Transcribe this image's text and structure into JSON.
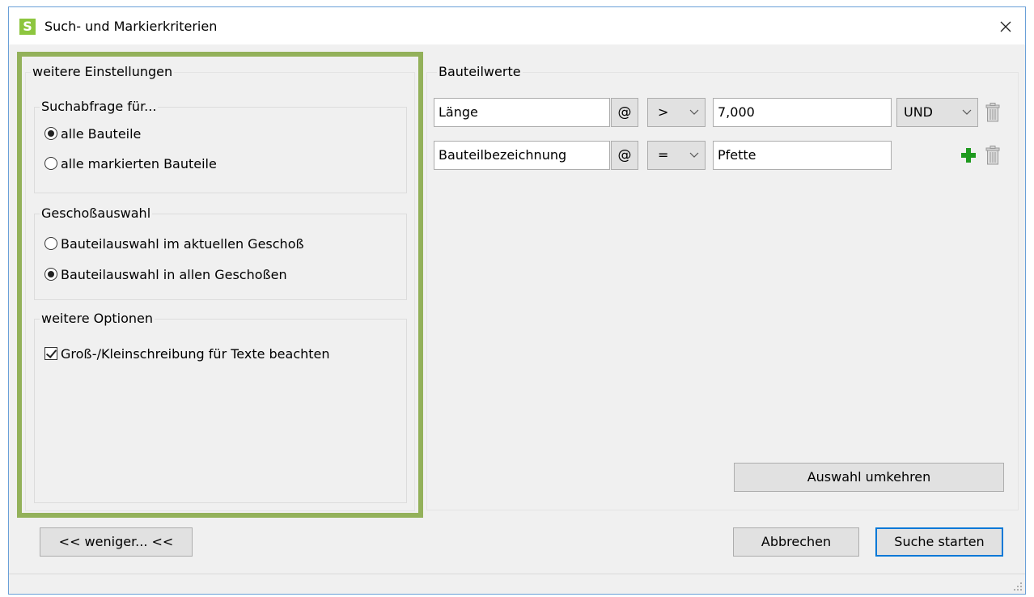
{
  "window": {
    "title": "Such- und Markierkriterien",
    "app_icon_letter": "S",
    "accent": "#8dc63f"
  },
  "left_panel": {
    "title": "weitere Einstellungen",
    "outline_color": "#93b15a",
    "search_group": {
      "title": "Suchabfrage für...",
      "options": [
        {
          "label": "alle Bauteile",
          "checked": true
        },
        {
          "label": "alle markierten Bauteile",
          "checked": false
        }
      ]
    },
    "floor_group": {
      "title": "Geschoßauswahl",
      "options": [
        {
          "label": "Bauteilauswahl im aktuellen Geschoß",
          "checked": false
        },
        {
          "label": "Bauteilauswahl in allen Geschoßen",
          "checked": true
        }
      ]
    },
    "more_group": {
      "title": "weitere Optionen",
      "checkbox": {
        "label": "Groß-/Kleinschreibung für Texte beachten",
        "checked": true
      }
    }
  },
  "right_panel": {
    "title": "Bauteilwerte",
    "rows": [
      {
        "field": "Länge",
        "at": "@",
        "operator": ">",
        "value": "7,000",
        "logic": "UND"
      },
      {
        "field": "Bauteilbezeichnung",
        "at": "@",
        "operator": "=",
        "value": "Pfette"
      }
    ],
    "invert_button": "Auswahl umkehren"
  },
  "footer": {
    "less_button": "<< weniger... <<",
    "cancel_button": "Abbrechen",
    "start_button": "Suche starten"
  }
}
